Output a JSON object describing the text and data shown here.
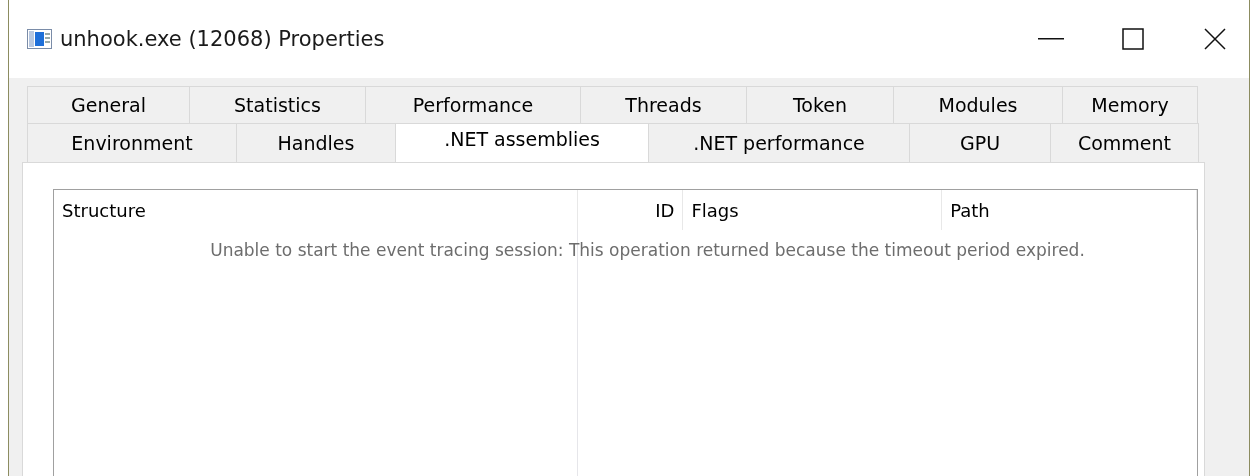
{
  "window": {
    "title": "unhook.exe (12068) Properties"
  },
  "tabs": [
    [
      {
        "label": "General",
        "selected": false
      },
      {
        "label": "Statistics",
        "selected": false
      },
      {
        "label": "Performance",
        "selected": false
      },
      {
        "label": "Threads",
        "selected": false
      },
      {
        "label": "Token",
        "selected": false
      },
      {
        "label": "Modules",
        "selected": false
      },
      {
        "label": "Memory",
        "selected": false
      }
    ],
    [
      {
        "label": "Environment",
        "selected": false
      },
      {
        "label": "Handles",
        "selected": false
      },
      {
        "label": ".NET assemblies",
        "selected": true
      },
      {
        "label": ".NET performance",
        "selected": false
      },
      {
        "label": "GPU",
        "selected": false
      },
      {
        "label": "Comment",
        "selected": false
      }
    ]
  ],
  "list": {
    "columns": [
      {
        "label": "Structure"
      },
      {
        "label": "ID"
      },
      {
        "label": "Flags"
      },
      {
        "label": "Path"
      }
    ],
    "message": "Unable to start the event tracing session: This operation returned because the timeout period expired."
  }
}
